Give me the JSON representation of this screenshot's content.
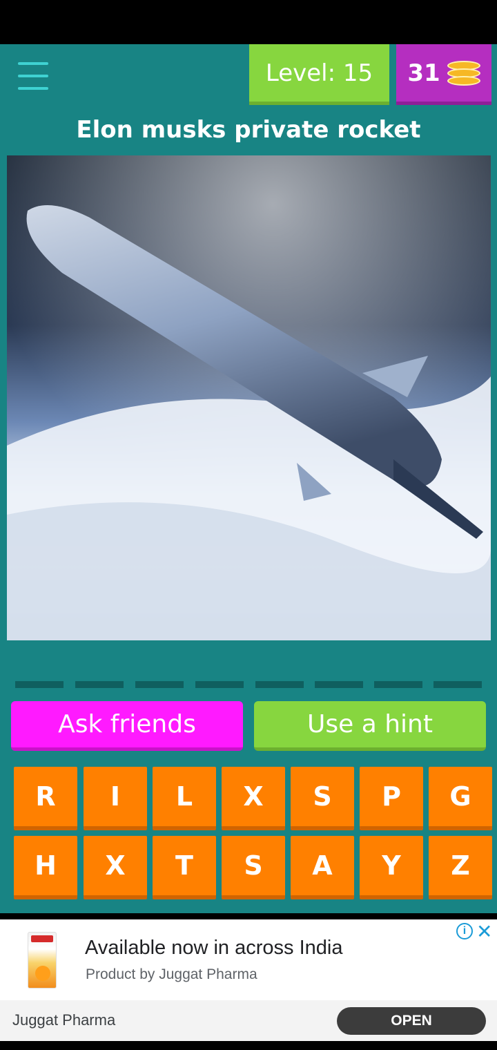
{
  "header": {
    "menu_icon": "hamburger-menu-icon",
    "level_text": "Level: 15",
    "coins": "31",
    "coins_icon": "coin-stack-icon"
  },
  "question": "Elon musks private rocket",
  "image": {
    "subject": "rocket-in-orbit-photo"
  },
  "answer": {
    "slot_count": 8,
    "color": "#0f5f5f"
  },
  "actions": {
    "ask_friends": "Ask friends",
    "use_hint": "Use a hint"
  },
  "letters": {
    "row1": [
      "R",
      "I",
      "L",
      "X",
      "S",
      "P",
      "G"
    ],
    "row2": [
      "H",
      "X",
      "T",
      "S",
      "A",
      "Y",
      "Z"
    ]
  },
  "ad": {
    "title": "Available now in across India",
    "subtitle": "Product by Juggat Pharma",
    "advertiser": "Juggat Pharma",
    "cta": "OPEN",
    "info_icon": "info-icon",
    "close_icon": "close-icon"
  },
  "colors": {
    "background": "#188484",
    "level": "#87d63f",
    "coins": "#b52ec0",
    "ask": "#ff1aff",
    "hint": "#87d63f",
    "key": "#ff8000"
  }
}
